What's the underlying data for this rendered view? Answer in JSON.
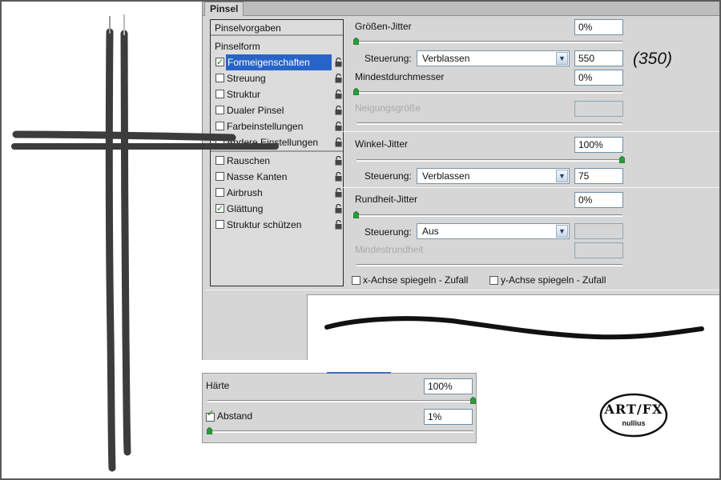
{
  "panel": {
    "tab_label": "Pinsel"
  },
  "list": {
    "header1": "Pinselvorgaben",
    "header2": "Pinselform",
    "items": [
      {
        "label": "Formeigenschaften",
        "checked": true,
        "selected": true
      },
      {
        "label": "Streuung",
        "checked": false
      },
      {
        "label": "Struktur",
        "checked": false
      },
      {
        "label": "Dualer Pinsel",
        "checked": false
      },
      {
        "label": "Farbeinstellungen",
        "checked": false
      },
      {
        "label": "Andere Einstellungen",
        "checked": false
      },
      {
        "label": "Rauschen",
        "checked": false
      },
      {
        "label": "Nasse Kanten",
        "checked": false
      },
      {
        "label": "Airbrush",
        "checked": false
      },
      {
        "label": "Glättung",
        "checked": true
      },
      {
        "label": "Struktur schützen",
        "checked": false
      }
    ]
  },
  "settings": {
    "size_jitter_label": "Größen-Jitter",
    "size_jitter_value": "0%",
    "size_jitter_slider": 0,
    "control_label": "Steuerung:",
    "control1_value": "Verblassen",
    "control1_number": "550",
    "min_diameter_label": "Mindestdurchmesser",
    "min_diameter_value": "0%",
    "min_diameter_slider": 0,
    "tilt_scale_label": "Neigungsgröße",
    "angle_jitter_label": "Winkel-Jitter",
    "angle_jitter_value": "100%",
    "angle_jitter_slider": 1.0,
    "control2_value": "Verblassen",
    "control2_number": "75",
    "roundness_jitter_label": "Rundheit-Jitter",
    "roundness_jitter_value": "0%",
    "roundness_jitter_slider": 0,
    "control3_value": "Aus",
    "min_roundness_label": "Mindestrundheit",
    "flip_x_label": "x-Achse spiegeln - Zufall",
    "flip_y_label": "y-Achse spiegeln - Zufall"
  },
  "annotation": "(350)",
  "tip_panel": {
    "hardness_label": "Härte",
    "hardness_value": "100%",
    "hardness_slider": 1.0,
    "spacing_label": "Abstand",
    "spacing_checked": true,
    "spacing_value": "1%",
    "spacing_slider": 0.01
  },
  "logo": {
    "line1": "ART/FX",
    "line2": "nullius"
  },
  "colors": {
    "selection": "#2864c8",
    "panel_bg": "#d6d6d6",
    "stroke": "#3c3c3c",
    "thumb": "#2a9a3a"
  }
}
